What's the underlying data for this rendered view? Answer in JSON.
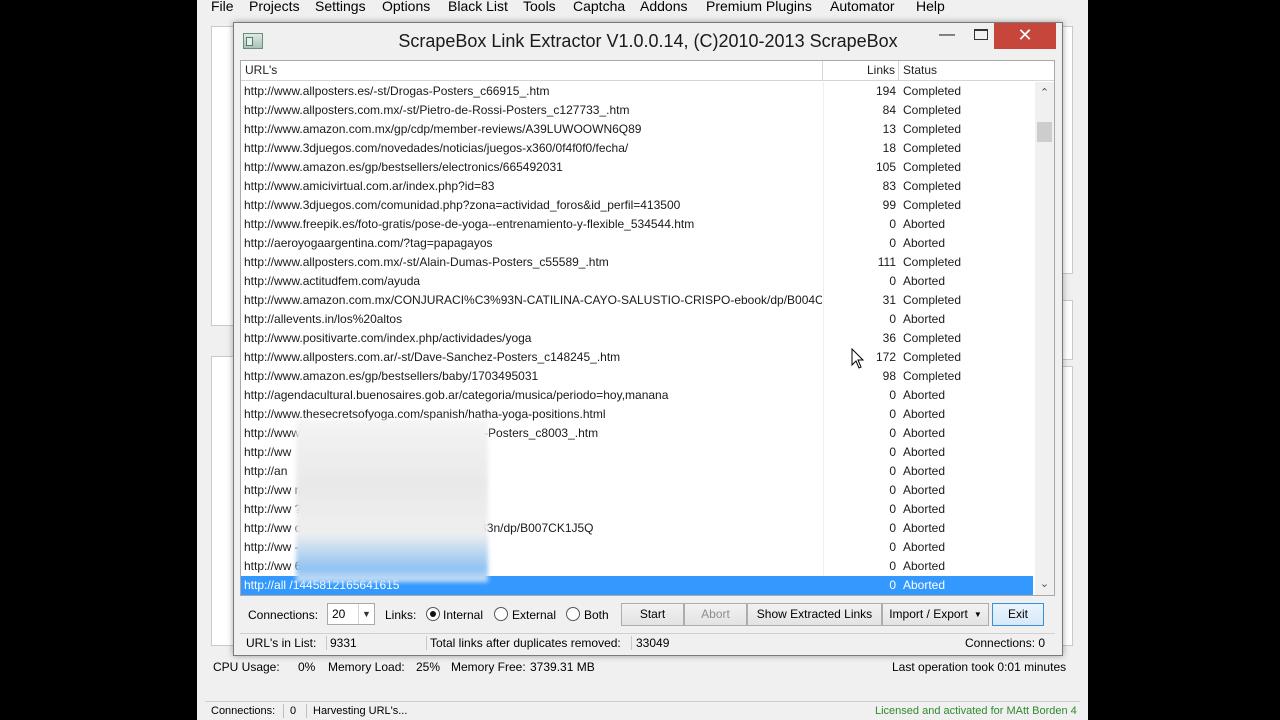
{
  "menu": [
    "File",
    "Projects",
    "Settings",
    "Options",
    "Black List",
    "Tools",
    "Captcha",
    "Addons",
    "Premium Plugins",
    "Automator",
    "Help"
  ],
  "dialog": {
    "title": "ScrapeBox Link Extractor V1.0.0.14, (C)2010-2013 ScrapeBox",
    "minimize_glyph": "—",
    "close_glyph": "✕"
  },
  "table": {
    "headers": {
      "url": "URL's",
      "links": "Links",
      "status": "Status"
    },
    "rows": [
      {
        "url": "http://www.allposters.es/-st/Drogas-Posters_c66915_.htm",
        "links": "194",
        "status": "Completed"
      },
      {
        "url": "http://www.allposters.com.mx/-st/Pietro-de-Rossi-Posters_c127733_.htm",
        "links": "84",
        "status": "Completed"
      },
      {
        "url": "http://www.amazon.com.mx/gp/cdp/member-reviews/A39LUWOOWN6Q89",
        "links": "13",
        "status": "Completed"
      },
      {
        "url": "http://www.3djuegos.com/novedades/noticias/juegos-x360/0f4f0f0/fecha/",
        "links": "18",
        "status": "Completed"
      },
      {
        "url": "http://www.amazon.es/gp/bestsellers/electronics/665492031",
        "links": "105",
        "status": "Completed"
      },
      {
        "url": "http://www.amicivirtual.com.ar/index.php?id=83",
        "links": "83",
        "status": "Completed"
      },
      {
        "url": "http://www.3djuegos.com/comunidad.php?zona=actividad_foros&id_perfil=413500",
        "links": "99",
        "status": "Completed"
      },
      {
        "url": "http://www.freepik.es/foto-gratis/pose-de-yoga--entrenamiento-y-flexible_534544.htm",
        "links": "0",
        "status": "Aborted"
      },
      {
        "url": "http://aeroyogaargentina.com/?tag=papagayos",
        "links": "0",
        "status": "Aborted"
      },
      {
        "url": "http://www.allposters.com.mx/-st/Alain-Dumas-Posters_c55589_.htm",
        "links": "111",
        "status": "Completed"
      },
      {
        "url": "http://www.actitudfem.com/ayuda",
        "links": "0",
        "status": "Aborted"
      },
      {
        "url": "http://www.amazon.com.mx/CONJURACI%C3%93N-CATILINA-CAYO-SALUSTIO-CRISPO-ebook/dp/B004C",
        "links": "31",
        "status": "Completed"
      },
      {
        "url": "http://allevents.in/los%20altos",
        "links": "0",
        "status": "Aborted"
      },
      {
        "url": "http://www.positivarte.com/index.php/actividades/yoga",
        "links": "36",
        "status": "Completed"
      },
      {
        "url": "http://www.allposters.com.ar/-st/Dave-Sanchez-Posters_c148245_.htm",
        "links": "172",
        "status": "Completed"
      },
      {
        "url": "http://www.amazon.es/gp/bestsellers/baby/1703495031",
        "links": "98",
        "status": "Completed"
      },
      {
        "url": "http://agendacultural.buenosaires.gob.ar/categoria/musica/periodo=hoy,manana",
        "links": "0",
        "status": "Aborted"
      },
      {
        "url": "http://www.thesecretsofyoga.com/spanish/hatha-yoga-positions.html",
        "links": "0",
        "status": "Aborted"
      },
      {
        "url": "http://www.allposters.com.mx/-st/Joy-Division-Posters_c8003_.htm",
        "links": "0",
        "status": "Aborted"
      },
      {
        "url": "http://ww",
        "links": "0",
        "status": "Aborted"
      },
      {
        "url": "http://an",
        "links": "0",
        "status": "Aborted"
      },
      {
        "url": "http://ww                                                    raine-Posters_i2548969_.htm",
        "links": "0",
        "status": "Aborted"
      },
      {
        "url": "http://ww                                                    ?docId=1001216041",
        "links": "0",
        "status": "Aborted"
      },
      {
        "url": "http://ww                                                    ores-manuales-fondos-fijaci%C3%B3n/dp/B007CK1J5Q",
        "links": "0",
        "status": "Aborted"
      },
      {
        "url": "http://ww                                                    -1929-Posters_c166073_.htm",
        "links": "0",
        "status": "Aborted"
      },
      {
        "url": "http://ww                                                    64655031",
        "links": "0",
        "status": "Aborted"
      },
      {
        "url": "http://all                                                    /1445812165641615",
        "links": "0",
        "status": "Aborted",
        "selected": true
      }
    ]
  },
  "controls": {
    "connections_label": "Connections:",
    "connections_value": "20",
    "links_label": "Links:",
    "internal_label": "Internal",
    "external_label": "External",
    "both_label": "Both",
    "selected_mode": "Internal",
    "start_label": "Start",
    "abort_label": "Abort",
    "show_extracted_label": "Show Extracted Links",
    "import_export_label": "Import / Export",
    "exit_label": "Exit"
  },
  "dialog_status": {
    "urls_label": "URL's in List:",
    "urls_value": "9331",
    "total_label": "Total links after duplicates removed:",
    "total_value": "33049",
    "connections_text": "Connections: 0"
  },
  "system_bar": {
    "cpu_label": "CPU Usage:",
    "cpu_value": "0%",
    "mem_load_label": "Memory Load:",
    "mem_load_value": "25%",
    "mem_free_label": "Memory Free:",
    "mem_free_value": "3739.31 MB",
    "last_op": "Last operation took 0:01 minutes"
  },
  "main_status": {
    "connections_label": "Connections:",
    "connections_value": "0",
    "activity": "Harvesting URL's...",
    "license": "Licensed and activated for MAtt Borden 4"
  },
  "colors": {
    "selection": "#3399ff",
    "close_button": "#c7463b",
    "license_text": "#2e8b2e"
  }
}
